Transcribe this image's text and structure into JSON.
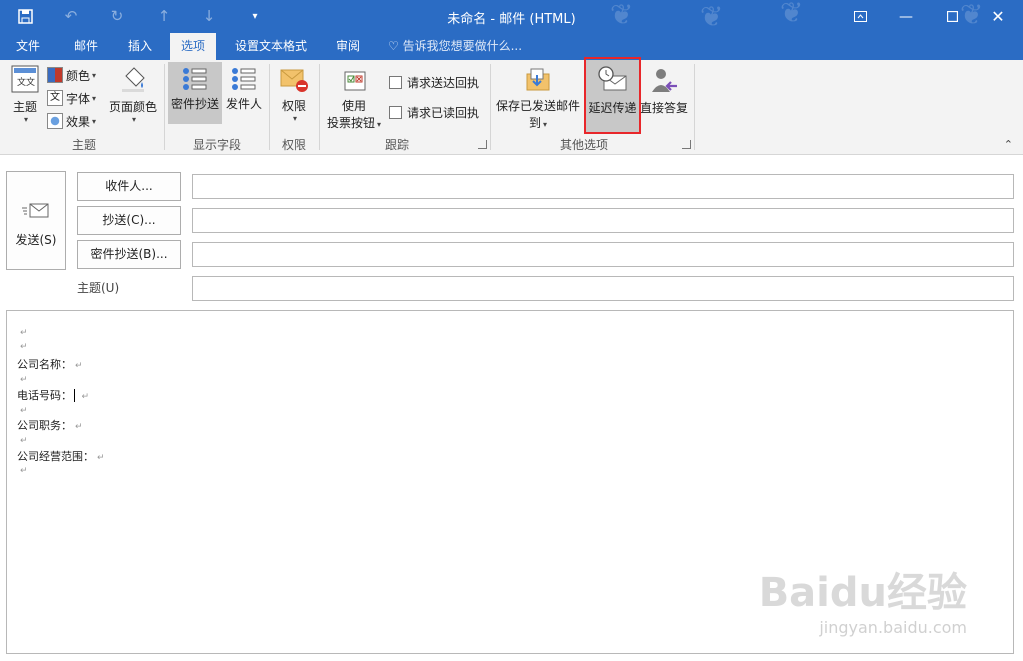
{
  "window": {
    "title": "未命名 - 邮件 (HTML)",
    "qat_icons": [
      "save-icon",
      "undo-icon",
      "redo-icon",
      "up-arrow-icon",
      "down-arrow-icon",
      "customize-icon"
    ],
    "controls": [
      "ribbon-display-icon",
      "minimize-icon",
      "maximize-icon",
      "close-icon"
    ]
  },
  "tabs": [
    {
      "label": "文件"
    },
    {
      "label": "邮件"
    },
    {
      "label": "插入"
    },
    {
      "label": "选项",
      "active": true
    },
    {
      "label": "设置文本格式"
    },
    {
      "label": "审阅"
    }
  ],
  "tellme": "告诉我您想要做什么...",
  "ribbon": {
    "theme": {
      "theme_label": "主题",
      "colors_label": "颜色",
      "fonts_label": "字体",
      "effects_label": "效果",
      "page_color_label": "页面颜色",
      "group_label": "主题"
    },
    "show_fields": {
      "bcc_label": "密件抄送",
      "from_label": "发件人",
      "group_label": "显示字段"
    },
    "permission": {
      "label": "权限",
      "group_label": "权限"
    },
    "tracking": {
      "voting_line1": "使用",
      "voting_line2": "投票按钮",
      "delivery_receipt": "请求送达回执",
      "read_receipt": "请求已读回执",
      "group_label": "跟踪"
    },
    "more_options": {
      "save_sent_line1": "保存已发送邮件",
      "save_sent_line2": "到",
      "delay_delivery": "延迟传递",
      "direct_replies": "直接答复",
      "group_label": "其他选项"
    }
  },
  "compose": {
    "send_label": "发送(S)",
    "to_button": "收件人...",
    "cc_button": "抄送(C)...",
    "bcc_button": "密件抄送(B)...",
    "subject_label": "主题(U)",
    "to_value": "",
    "cc_value": "",
    "bcc_value": "",
    "subject_value": ""
  },
  "body_lines": [
    "",
    "",
    "公司名称：",
    "",
    "电话号码：",
    "",
    "公司职务：",
    "",
    "公司经营范围：",
    ""
  ],
  "colors": {
    "accent": "#2b6cc4",
    "highlight_box": "#e8262a"
  },
  "watermark": {
    "main": "Baidu经验",
    "sub": "jingyan.baidu.com"
  }
}
